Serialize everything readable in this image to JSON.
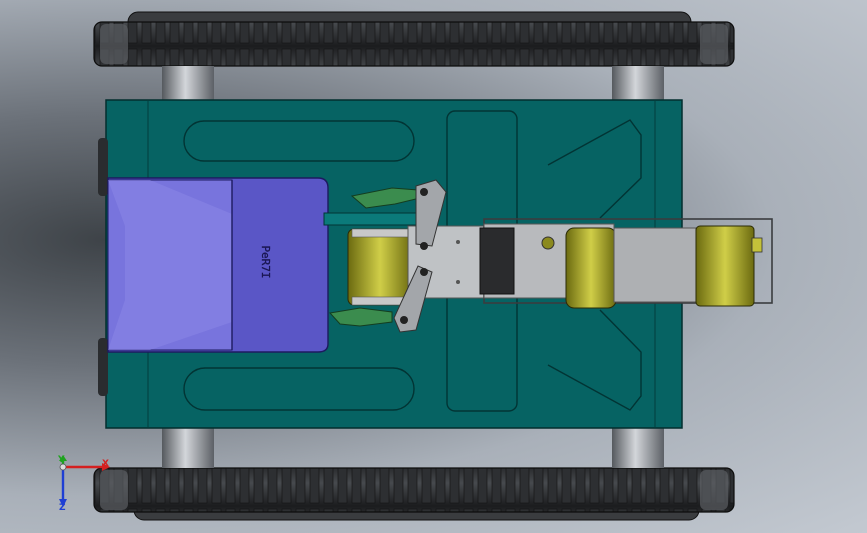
{
  "viewport": {
    "name": "3d-model-viewport",
    "view": "top"
  },
  "model": {
    "hopper_label": "PeR7I",
    "track_count": 2,
    "colors": {
      "chassis": "#066363",
      "chassis_outline": "#022e2e",
      "hopper": "#5a56c6",
      "hopper_inner": "#7874dd",
      "tread": "#2a2b2d",
      "tread_highlight": "#4a4c4f",
      "axle": "#8c9198",
      "motor": "#8b8a1e",
      "motor_light": "#c4c23a",
      "arm": "#3b8c4e",
      "frame": "#b8babd"
    }
  },
  "triad": {
    "x_label": "X",
    "y_label": "Y",
    "z_label": "Z",
    "x_color": "#d42020",
    "y_color": "#1fa31f",
    "z_color": "#1f3fd4"
  }
}
